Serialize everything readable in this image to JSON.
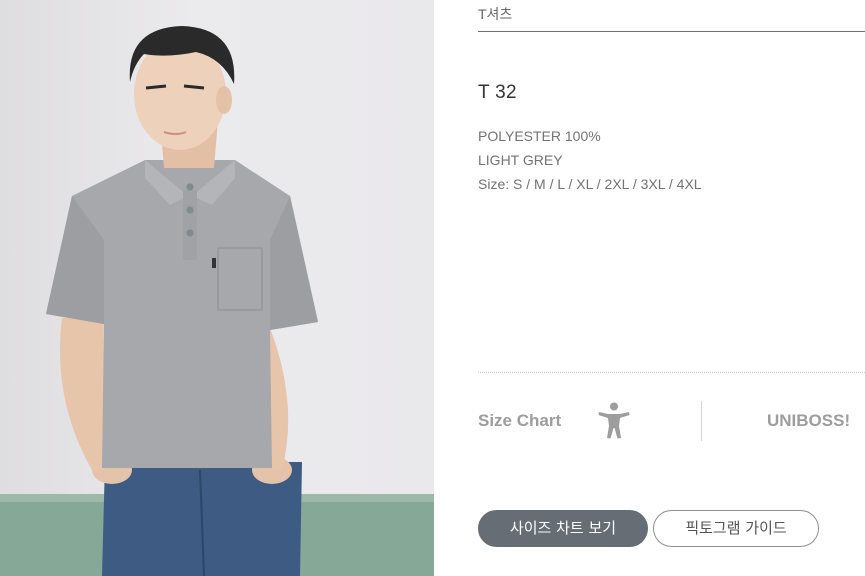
{
  "category": "T셔츠",
  "product": {
    "name": "T 32",
    "specs": [
      "POLYESTER 100%",
      "LIGHT GREY",
      "Size: S / M / L / XL / 2XL / 3XL / 4XL"
    ]
  },
  "size_section": {
    "label": "Size Chart",
    "icon": "person-figure-icon",
    "brand": "UNIBOSS!"
  },
  "buttons": {
    "size_chart": "사이즈 차트 보기",
    "pictogram_guide": "픽토그램 가이드"
  },
  "colors": {
    "primary_button": "#676d75",
    "label_grey": "#9d9d9d",
    "shirt": "#a6a8ac"
  }
}
